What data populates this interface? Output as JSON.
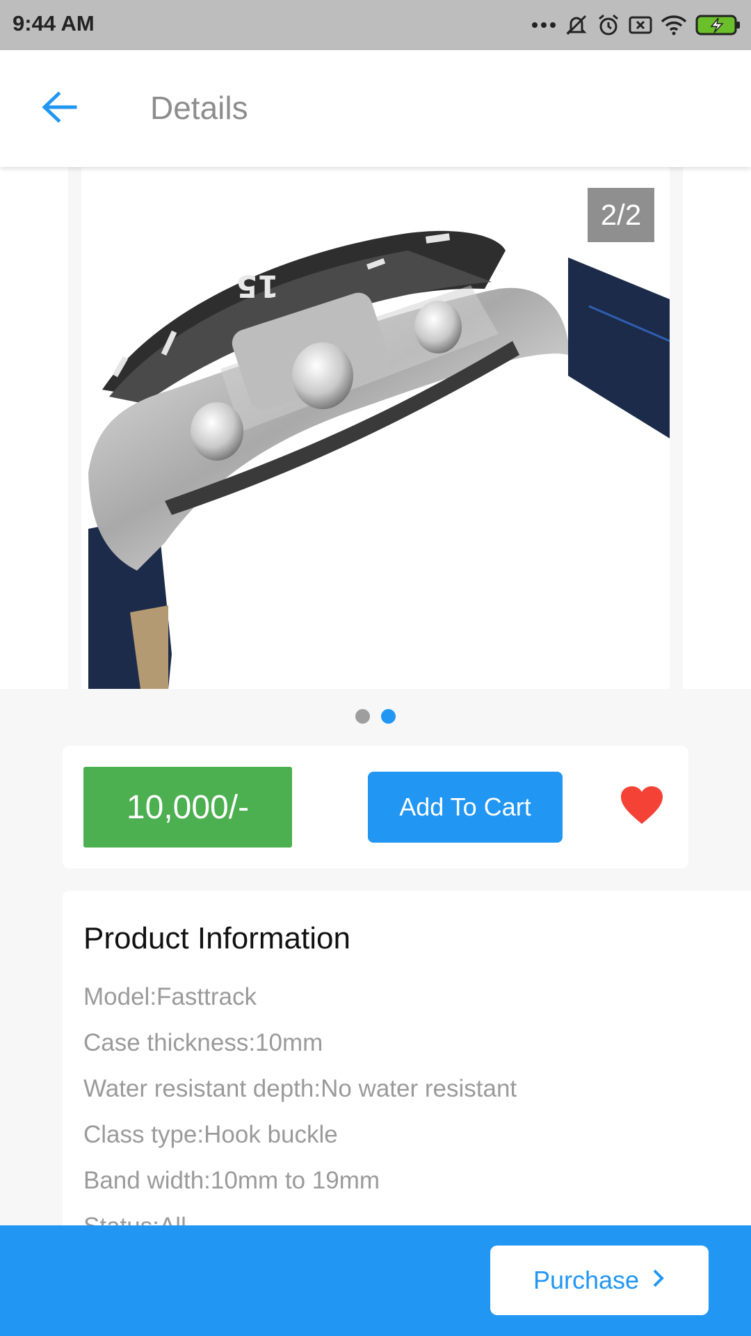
{
  "status_bar": {
    "time": "9:44 AM",
    "icons": [
      "more-dots-icon",
      "mute-icon",
      "alarm-icon",
      "sim-off-icon",
      "wifi-icon",
      "battery-charging-icon"
    ]
  },
  "app_bar": {
    "title": "Details",
    "back_icon": "arrow-left-icon"
  },
  "carousel": {
    "counter": "2/2",
    "total_slides": 2,
    "active_slide": 2
  },
  "price_card": {
    "price": "10,000/-",
    "add_to_cart": "Add To Cart",
    "favorite_icon": "heart-icon"
  },
  "product_info": {
    "title": "Product Information",
    "rows": [
      "Model:Fasttrack",
      "Case thickness:10mm",
      "Water resistant depth:No water resistant",
      "Class type:Hook buckle",
      "Band width:10mm to 19mm",
      "Status:All"
    ]
  },
  "bottom_bar": {
    "purchase": "Purchase",
    "chevron_icon": "chevron-right-icon"
  },
  "colors": {
    "accent": "#2196f3",
    "price_green": "#4caf50",
    "heart_red": "#f44336"
  }
}
